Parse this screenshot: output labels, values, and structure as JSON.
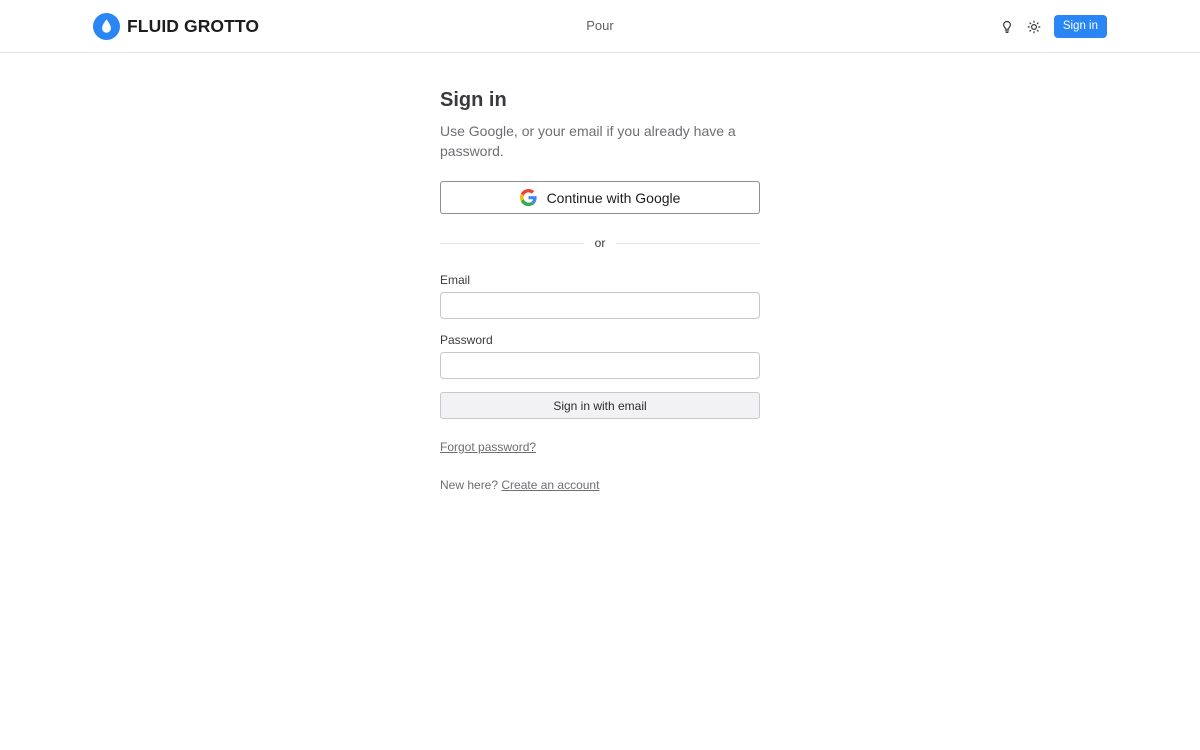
{
  "header": {
    "brand_name": "FLUID GROTTO",
    "logo_icon": "water-drop-icon",
    "nav_center_label": "Pour",
    "hint_icon": "lightbulb-icon",
    "theme_icon": "sun-icon",
    "signin_label": "Sign in",
    "accent_color": "#2a86f5"
  },
  "auth": {
    "title": "Sign in",
    "subtitle": "Use Google, or your email if you already have a password.",
    "google_button_label": "Continue with Google",
    "google_icon": "google-icon",
    "divider_text": "or",
    "email_label": "Email",
    "email_value": "",
    "email_placeholder": "",
    "password_label": "Password",
    "password_value": "",
    "password_placeholder": "",
    "email_submit_label": "Sign in with email",
    "forgot_password_label": "Forgot password?",
    "new_here_text": "New here?",
    "create_account_label": "Create an account"
  }
}
